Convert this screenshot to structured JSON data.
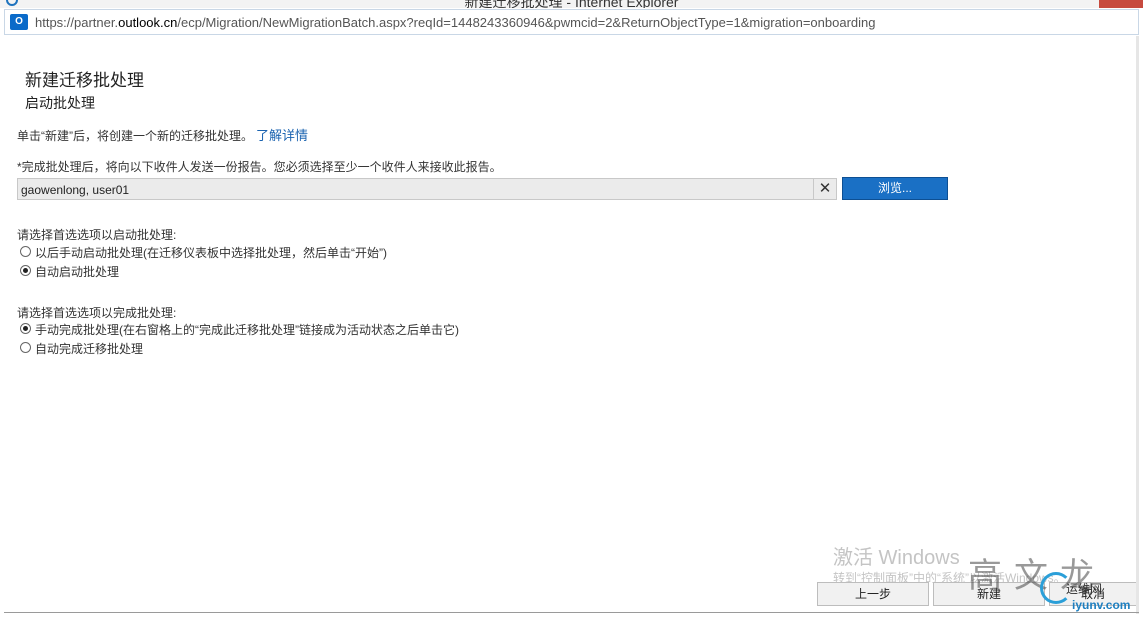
{
  "window": {
    "title": "新建迁移批处理 - Internet Explorer"
  },
  "address_bar": {
    "url_prefix": "https://partner.",
    "url_domain": "outlook.cn",
    "url_rest": "/ecp/Migration/NewMigrationBatch.aspx?reqId=1448243360946&pwmcid=2&ReturnObjectType=1&migration=onboarding",
    "site_icon": "outlook-icon",
    "site_icon_text": "O"
  },
  "page": {
    "title": "新建迁移批处理",
    "subtitle": "启动批处理",
    "intro_text": "单击“新建”后，将创建一个新的迁移批处理。",
    "learn_more_link": "了解详情",
    "report_note": "*完成批处理后，将向以下收件人发送一份报告。您必须选择至少一个收件人来接收此报告。",
    "recipients_value": "gaowenlong, user01",
    "clear_icon": "close-icon",
    "clear_glyph": "✕",
    "browse_label": "浏览..."
  },
  "start_group": {
    "label": "请选择首选选项以启动批处理:",
    "options": [
      {
        "label": "以后手动启动批处理(在迁移仪表板中选择批处理，然后单击“开始”)",
        "selected": false
      },
      {
        "label": "自动启动批处理",
        "selected": true
      }
    ]
  },
  "complete_group": {
    "label": "请选择首选选项以完成批处理:",
    "options": [
      {
        "label": "手动完成批处理(在右窗格上的“完成此迁移批处理”链接成为活动状态之后单击它)",
        "selected": true
      },
      {
        "label": "自动完成迁移批处理",
        "selected": false
      }
    ]
  },
  "overlay": {
    "activation_title": "激活 Windows",
    "activation_subtitle": "转到“控制面板”中的“系统”以激活Windows。",
    "signature": "高文龙",
    "logo_top": "运维网",
    "logo_bottom": "iyunv.com"
  },
  "footer": {
    "back_label": "上一步",
    "new_label": "新建",
    "cancel_label": "取消"
  }
}
